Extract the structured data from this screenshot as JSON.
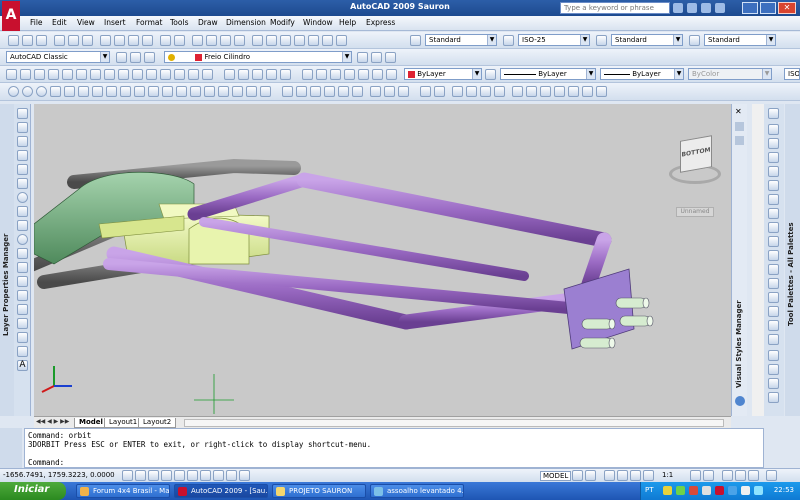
{
  "window": {
    "title": "AutoCAD 2009 Sauron",
    "search_placeholder": "Type a keyword or phrase"
  },
  "menu": [
    "File",
    "Edit",
    "View",
    "Insert",
    "Format",
    "Tools",
    "Draw",
    "Dimension",
    "Modify",
    "Window",
    "Help",
    "Express"
  ],
  "styles": {
    "text_style": "Standard",
    "dim_style": "ISO-25",
    "table_style": "Standard",
    "mleader_style": "Standard"
  },
  "workspace": "AutoCAD Classic",
  "layer": "Freio Cilindro",
  "properties": {
    "color": "ByLayer",
    "linetype": "ByLayer",
    "lineweight": "ByLayer",
    "plotstyle": "ByColor"
  },
  "iso_field": "ISO",
  "viewcube": {
    "face": "BOTTOM",
    "ucs": "Unnamed"
  },
  "side_labels": {
    "left": "Layer Properties Manager",
    "vs": "Visual Styles Manager",
    "right": "Tool Palettes - All Palettes"
  },
  "layout_tabs": [
    "Model",
    "Layout1",
    "Layout2"
  ],
  "command_lines": [
    "Command: orbit",
    "3DORBIT Press ESC or ENTER to exit, or right-click to display shortcut-menu.",
    "",
    "Command:"
  ],
  "status": {
    "coords": "-1656.7491, 1759.3223, 0.0000",
    "model": "MODEL",
    "scale": "1:1"
  },
  "taskbar": {
    "start": "Iniciar",
    "tasks": [
      "Forum 4x4 Brasil - Ma...",
      "AutoCAD 2009 - [Sau...",
      "PROJETO SAURON",
      "assoalho levantado 4..."
    ],
    "lang": "PT",
    "clock": "22:53"
  },
  "colors": {
    "accent": "#2c5ea8",
    "frame_purple": "#9b6bc4",
    "yellow_part": "#e4f0a6",
    "green_part": "#7fb58c",
    "grey_tube": "#6f6f6f"
  }
}
